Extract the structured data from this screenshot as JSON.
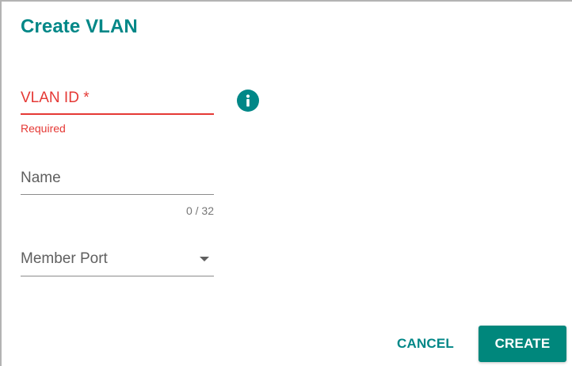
{
  "dialog": {
    "title": "Create VLAN"
  },
  "fields": {
    "vlan_id": {
      "label": "VLAN ID *",
      "error": "Required",
      "info_icon": "info-icon"
    },
    "name": {
      "label": "Name",
      "counter": "0 / 32"
    },
    "member_port": {
      "label": "Member Port",
      "icon": "dropdown-arrow-icon"
    }
  },
  "actions": {
    "cancel_label": "CANCEL",
    "create_label": "CREATE"
  },
  "colors": {
    "accent": "#008787",
    "error": "#e53935",
    "primary_button": "#00877c"
  }
}
